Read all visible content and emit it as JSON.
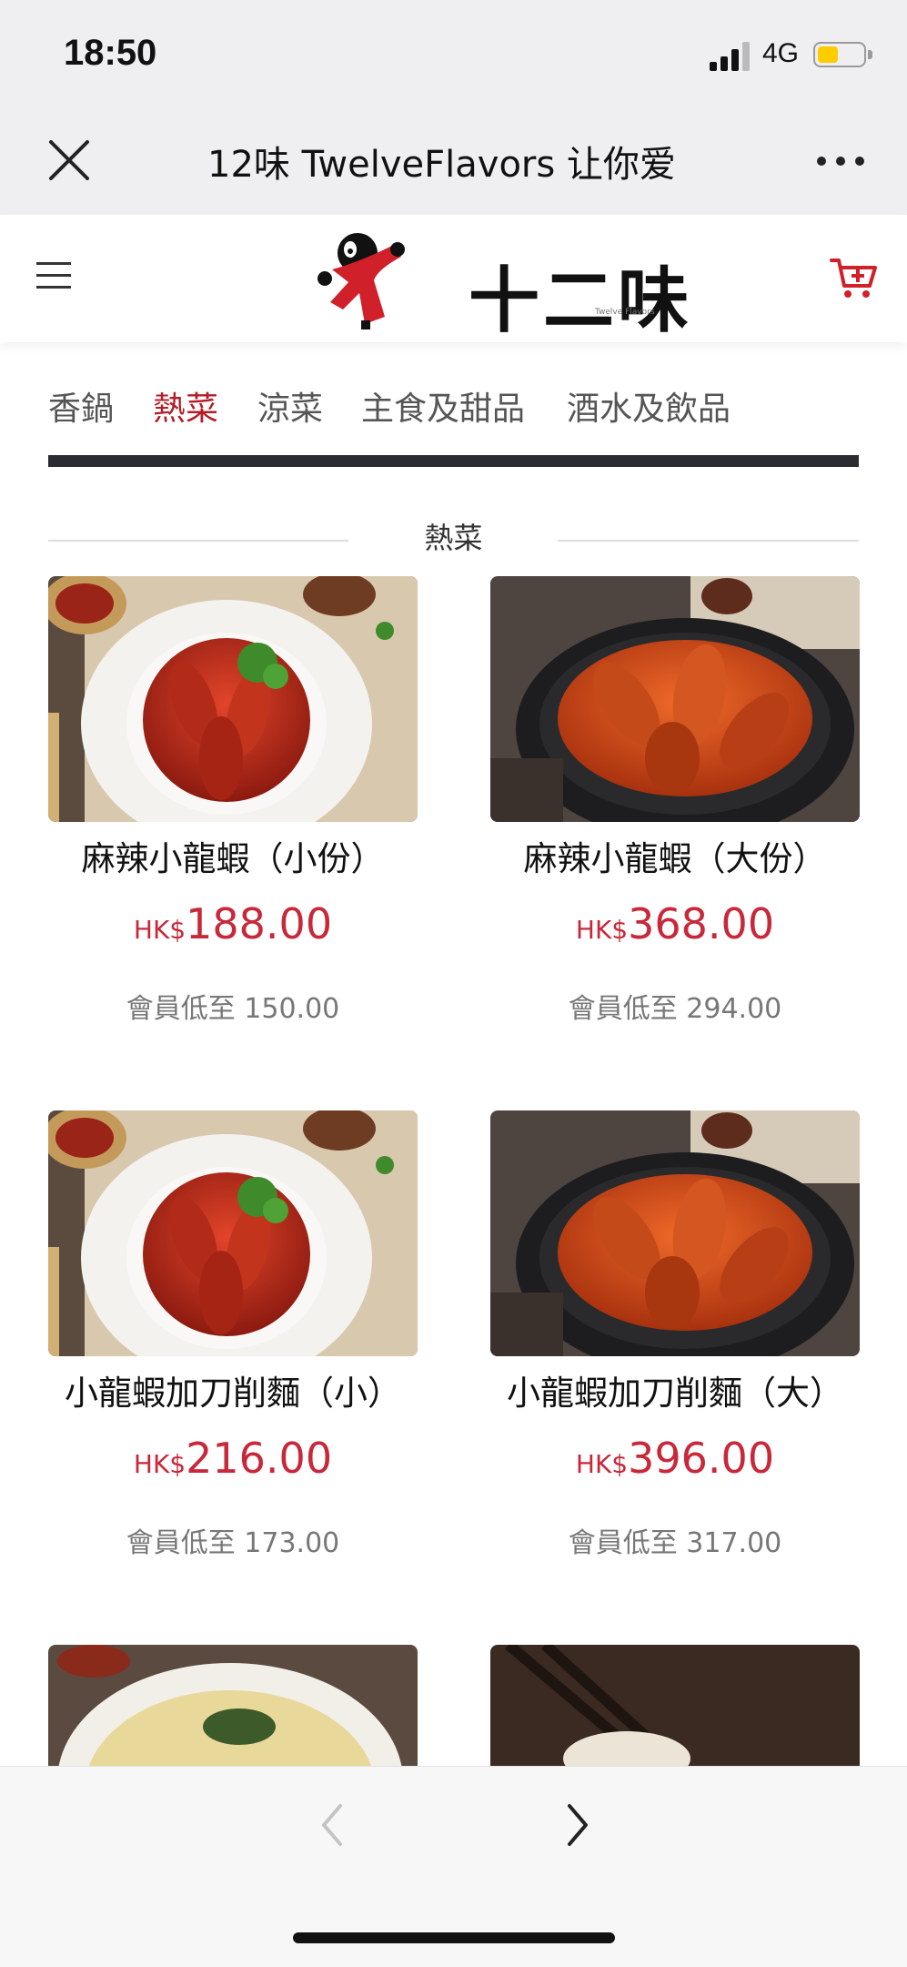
{
  "status": {
    "time": "18:50",
    "network": "4G",
    "battery_level": 0.45
  },
  "nav": {
    "title": "12味 TwelveFlavors 让你爱"
  },
  "header": {
    "logo_text": "十二味",
    "logo_sub": "Twelve Flavors"
  },
  "colors": {
    "accent": "#c8283a",
    "tab_active": "#b41d27"
  },
  "tabs": [
    {
      "label": "香鍋"
    },
    {
      "label": "熱菜"
    },
    {
      "label": "涼菜"
    },
    {
      "label": "主食及甜品"
    },
    {
      "label": "酒水及飲品"
    }
  ],
  "active_tab": "熱菜",
  "section": {
    "title": "熱菜"
  },
  "products": [
    {
      "name": "麻辣小龍蝦（小份）",
      "currency": "HK$",
      "price": "188.00",
      "member_price": "會員低至 150.00",
      "image": "crayfish-white-plate"
    },
    {
      "name": "麻辣小龍蝦（大份）",
      "currency": "HK$",
      "price": "368.00",
      "member_price": "會員低至 294.00",
      "image": "crayfish-black-bowl"
    },
    {
      "name": "小龍蝦加刀削麵（小）",
      "currency": "HK$",
      "price": "216.00",
      "member_price": "會員低至 173.00",
      "image": "crayfish-white-plate"
    },
    {
      "name": "小龍蝦加刀削麵（大）",
      "currency": "HK$",
      "price": "396.00",
      "member_price": "會員低至 317.00",
      "image": "crayfish-black-bowl"
    }
  ],
  "partial_products": [
    {
      "image": "noodle-soup-bowl"
    },
    {
      "image": "dumpling-chopsticks"
    }
  ]
}
